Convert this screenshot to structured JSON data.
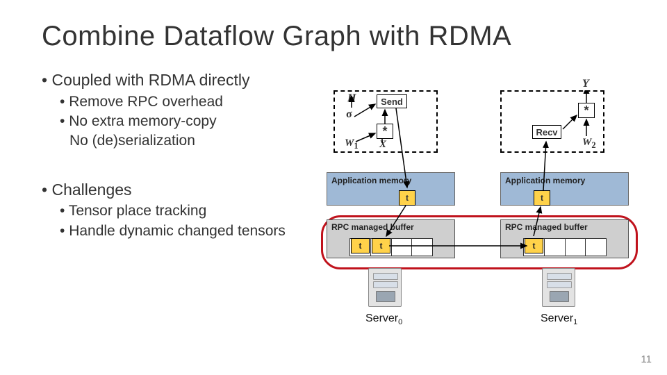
{
  "title": "Combine Dataflow Graph with RDMA",
  "bullets": {
    "a": "Coupled with RDMA directly",
    "a1": "Remove RPC overhead",
    "a2": "No extra memory-copy",
    "a2cont": "No (de)serialization",
    "b": "Challenges",
    "b1": "Tensor place tracking",
    "b2": "Handle dynamic changed tensors"
  },
  "diagram": {
    "send": "Send",
    "recv": "Recv",
    "star": "*",
    "H": "H",
    "sigma": "σ",
    "W1": "W",
    "W1sub": "1",
    "X": "X",
    "Y": "Y",
    "W2": "W",
    "W2sub": "2",
    "appmem": "Application memory",
    "rpc": "RPC managed buffer",
    "t": "t",
    "server0": "Server",
    "server0sub": "0",
    "server1": "Server",
    "server1sub": "1"
  },
  "page": "11"
}
